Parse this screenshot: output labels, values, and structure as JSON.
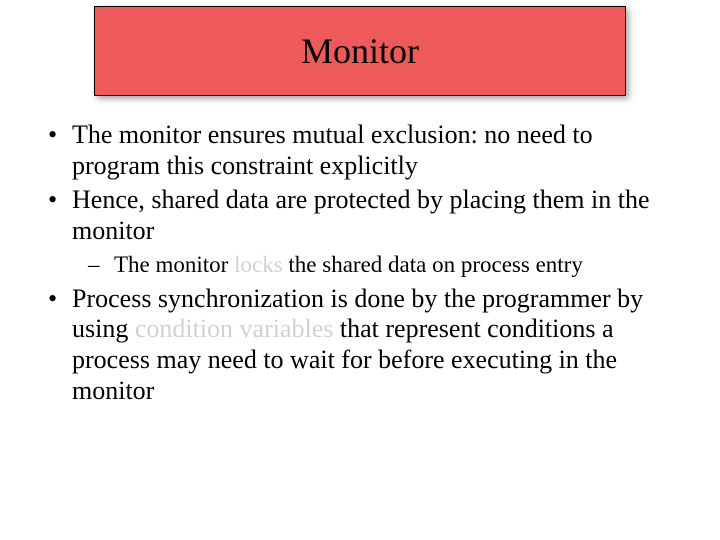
{
  "title": "Monitor",
  "bullets": {
    "b1": "The monitor ensures mutual exclusion: no need to program this constraint explicitly",
    "b2": "Hence, shared data are protected by placing them in the monitor",
    "b2_sub1_a": "The monitor ",
    "b2_sub1_locks": "locks",
    "b2_sub1_b": " the shared data on process entry",
    "b3_a": "Process synchronization is done by the programmer by using ",
    "b3_cv": "condition variables",
    "b3_b": " that represent conditions a process may need to wait for before executing in the monitor"
  }
}
